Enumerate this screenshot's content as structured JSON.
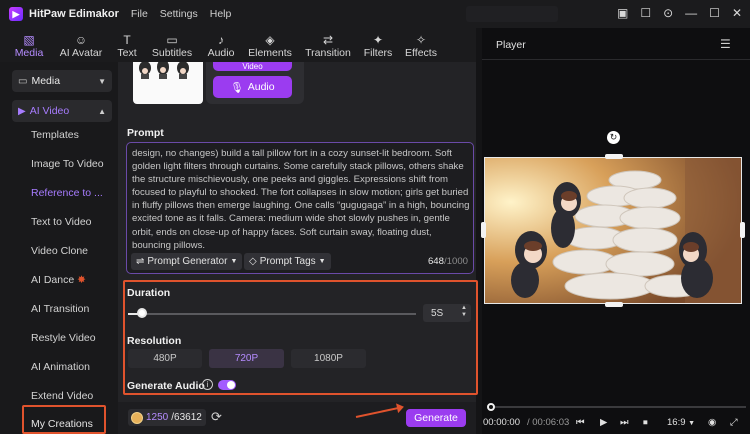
{
  "app": {
    "name": "HitPaw Edimakor",
    "menus": [
      "File",
      "Settings",
      "Help"
    ]
  },
  "colors": {
    "accent": "#9b3cf0",
    "accent_text": "#b58cff",
    "highlight": "#e0532d"
  },
  "titlebar_icons": [
    "layout-icon",
    "feedback-icon",
    "download-icon",
    "minimize-icon",
    "maximize-icon",
    "close-icon"
  ],
  "tools": [
    {
      "label": "Media",
      "icon": "media-icon",
      "active": true
    },
    {
      "label": "AI Avatar",
      "icon": "avatar-icon"
    },
    {
      "label": "Text",
      "icon": "text-icon"
    },
    {
      "label": "Subtitles",
      "icon": "subtitles-icon"
    },
    {
      "label": "Audio",
      "icon": "audio-icon"
    },
    {
      "label": "Elements",
      "icon": "elements-icon"
    },
    {
      "label": "Transition",
      "icon": "transition-icon"
    },
    {
      "label": "Filters",
      "icon": "filters-icon"
    },
    {
      "label": "Effects",
      "icon": "effects-icon"
    }
  ],
  "sidebar": {
    "groups": [
      {
        "label": "Media"
      },
      {
        "label": "AI Video"
      }
    ],
    "items": [
      "Templates",
      "Image To Video",
      "Reference to ...",
      "Text to Video",
      "Video Clone",
      "AI Dance",
      "AI Transition",
      "Restyle Video",
      "AI Animation",
      "Extend Video",
      "My Creations"
    ],
    "active_item": "Reference to ..."
  },
  "media": {
    "video_label": "Video",
    "audio_label": "Audio"
  },
  "prompt": {
    "title": "Prompt",
    "text": "design, no changes) build a tall pillow fort in a cozy sunset-lit bedroom. Soft golden light filters through curtains. Some carefully stack pillows, others shake the structure mischievously, one peeks and giggles. Expressions shift from focused to playful to shocked. The fort collapses in slow motion; girls get buried in fluffy pillows then emerge laughing. One calls “gugugaga” in a high, bouncing excited tone as it falls. Camera: medium wide shot slowly pushes in, gentle orbit, ends on close-up of happy faces. Soft curtain sway, floating dust, bouncing pillows.",
    "generator_label": "Prompt Generator",
    "tags_label": "Prompt Tags",
    "count": "648",
    "max": "/1000"
  },
  "duration": {
    "title": "Duration",
    "value": "5S",
    "fraction": 0.05
  },
  "resolution": {
    "title": "Resolution",
    "options": [
      "480P",
      "720P",
      "1080P"
    ],
    "selected": "720P"
  },
  "generate_audio": {
    "label": "Generate Audio",
    "enabled": true
  },
  "footer": {
    "credits_used": "1250",
    "credits_total": "/63612",
    "generate_label": "Generate"
  },
  "player": {
    "title": "Player",
    "current_time": "00:00:00",
    "total_time": "/ 00:06:03",
    "aspect": "16:9"
  }
}
